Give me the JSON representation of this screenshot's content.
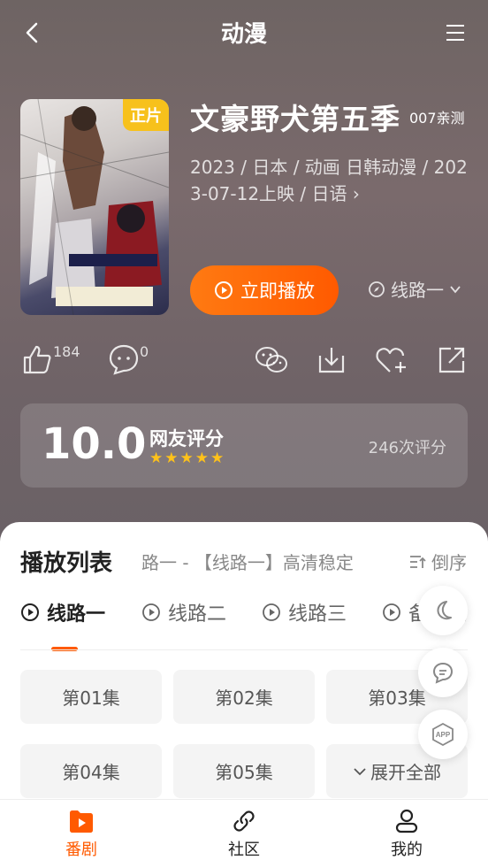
{
  "header": {
    "title": "动漫"
  },
  "anime": {
    "title": "文豪野犬第五季",
    "tester": "007亲测",
    "badge": "正片",
    "meta": "2023 / 日本 / 动画 日韩动漫 / 2023-07-12上映 / 日语 ›",
    "play_label": "立即播放",
    "route_label": "线路一"
  },
  "actions": {
    "like_count": "184",
    "comment_count": "0"
  },
  "rating": {
    "score": "10.0",
    "label": "网友评分",
    "count": "246次评分",
    "stars": 5
  },
  "playlist": {
    "title": "播放列表",
    "marquee": "路一 - 【线路一】高清稳定",
    "sort_label": "倒序",
    "tabs": [
      "线路一",
      "线路二",
      "线路三",
      "备用线"
    ],
    "episodes": [
      "第01集",
      "第02集",
      "第03集",
      "第04集",
      "第05集"
    ],
    "expand_label": "展开全部"
  },
  "nav": {
    "items": [
      "番剧",
      "社区",
      "我的"
    ]
  },
  "colors": {
    "accent": "#ff5a00",
    "star": "#ffc21a",
    "badge": "#f7c11c"
  }
}
